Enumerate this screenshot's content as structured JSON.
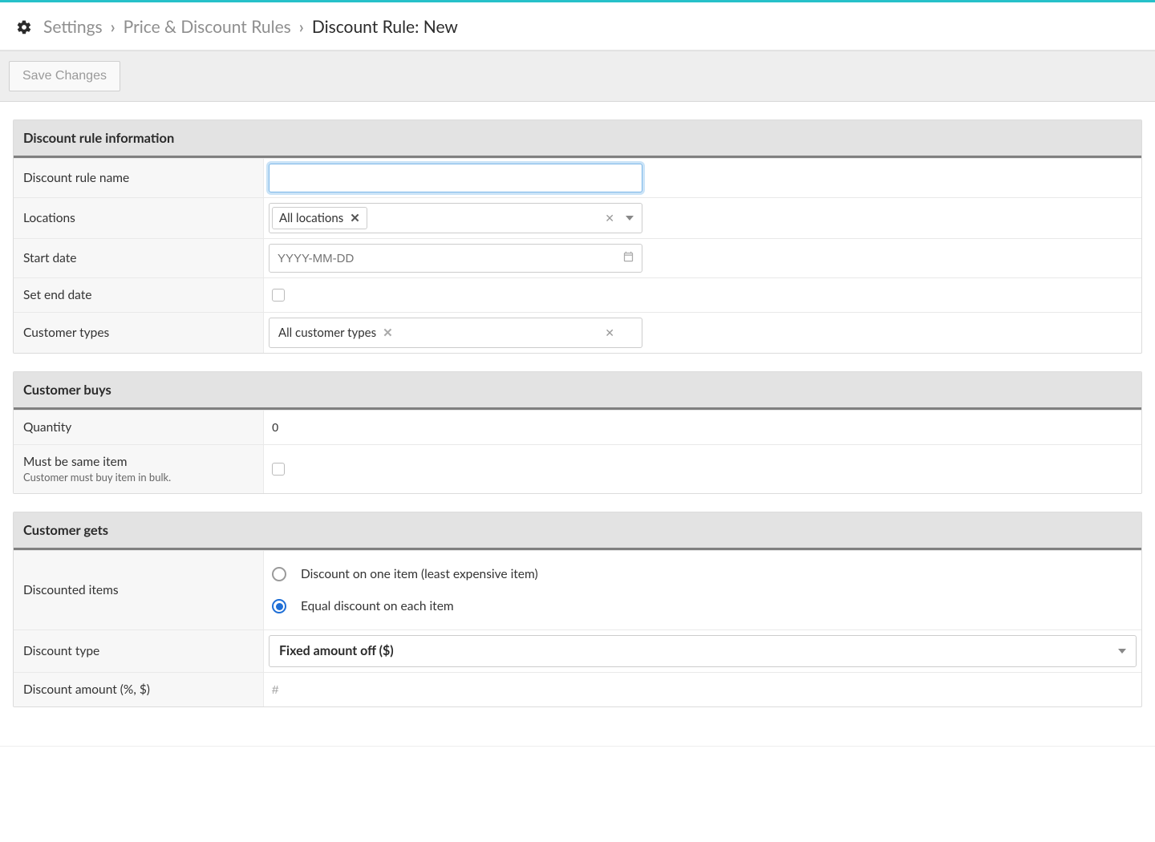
{
  "header": {
    "breadcrumb": {
      "settings": "Settings",
      "rules": "Price & Discount Rules",
      "current": "Discount Rule: New"
    }
  },
  "toolbar": {
    "save_label": "Save Changes"
  },
  "sections": {
    "info": {
      "title": "Discount rule information",
      "rows": {
        "name_label": "Discount rule name",
        "name_value": "",
        "locations_label": "Locations",
        "locations_chip": "All locations",
        "start_date_label": "Start date",
        "start_date_placeholder": "YYYY-MM-DD",
        "set_end_date_label": "Set end date",
        "customer_types_label": "Customer types",
        "customer_types_chip": "All customer types"
      }
    },
    "buys": {
      "title": "Customer buys",
      "rows": {
        "quantity_label": "Quantity",
        "quantity_value": "0",
        "same_item_label": "Must be same item",
        "same_item_sub": "Customer must buy item in bulk."
      }
    },
    "gets": {
      "title": "Customer gets",
      "rows": {
        "discounted_items_label": "Discounted items",
        "radio_one": "Discount on one item (least expensive item)",
        "radio_each": "Equal discount on each item",
        "discount_type_label": "Discount type",
        "discount_type_value": "Fixed amount off ($)",
        "discount_amount_label": "Discount amount (%, $)",
        "discount_amount_placeholder": "#"
      }
    }
  }
}
